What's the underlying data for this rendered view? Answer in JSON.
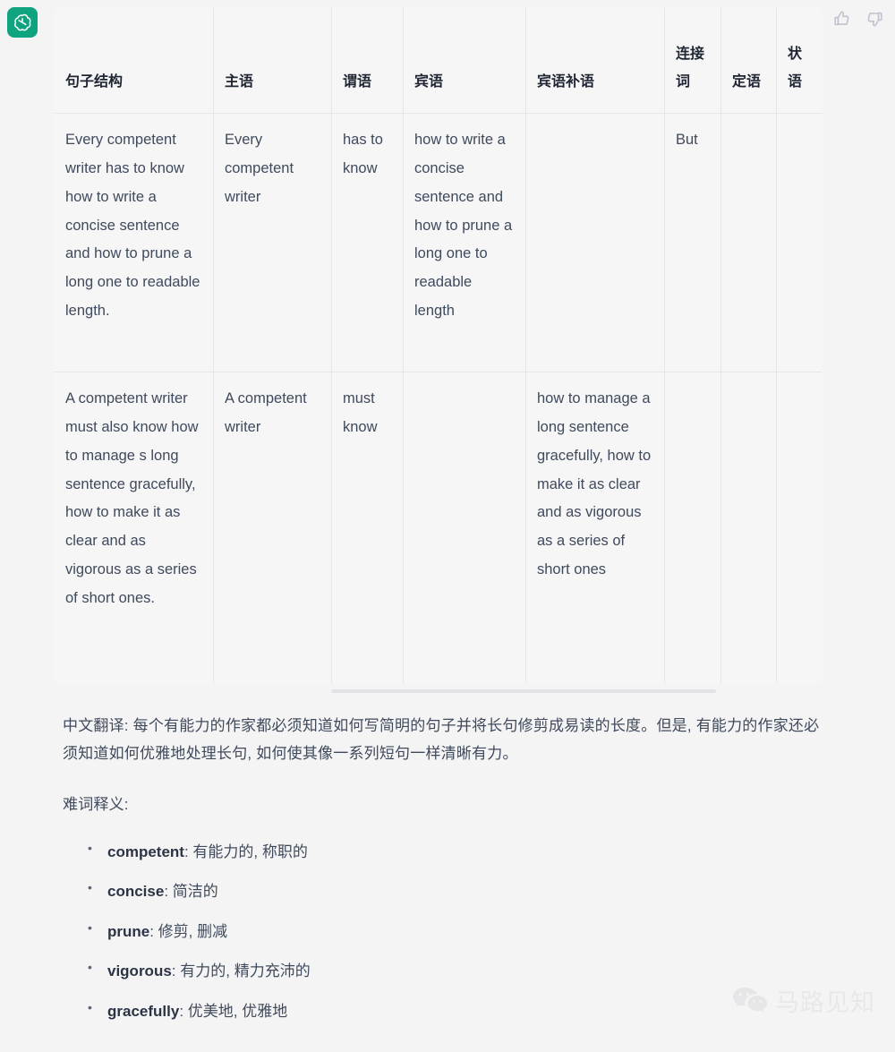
{
  "avatar": {
    "name": "chatgpt-logo"
  },
  "feedback": {
    "thumbs_up_label": "thumbs-up",
    "thumbs_down_label": "thumbs-down"
  },
  "table": {
    "headers": [
      "句子结构",
      "主语",
      "谓语",
      "宾语",
      "宾语补语",
      "连接词",
      "定语",
      "状语"
    ],
    "rows": [
      {
        "sentence": "Every competent writer has to know how to write a concise sentence and how to prune a long one to readable length.",
        "subject": "Every competent writer",
        "predicate": "has to know",
        "object": "how to write a concise sentence and how to prune a long one to readable length",
        "object_complement": "",
        "conjunction": "But",
        "attributive": "",
        "adverbial": ""
      },
      {
        "sentence": "A competent writer must also know how to manage s long sentence gracefully, how to make it as clear and as vigorous as a series of short ones.",
        "subject": "A competent writer",
        "predicate": "must know",
        "object": "",
        "object_complement": "how to manage a long sentence gracefully, how to make it as clear and as vigorous as a series of short ones",
        "conjunction": "",
        "attributive": "",
        "adverbial": ""
      }
    ]
  },
  "translation": {
    "text": "中文翻译: 每个有能力的作家都必须知道如何写简明的句子并将长句修剪成易读的长度。但是, 有能力的作家还必须知道如何优雅地处理长句, 如何使其像一系列短句一样清晰有力。"
  },
  "vocab_section": {
    "title": "难词释义:",
    "items": [
      {
        "term": "competent",
        "definition": ": 有能力的, 称职的"
      },
      {
        "term": "concise",
        "definition": ": 简洁的"
      },
      {
        "term": "prune",
        "definition": ": 修剪, 删减"
      },
      {
        "term": "vigorous",
        "definition": ": 有力的, 精力充沛的"
      },
      {
        "term": "gracefully",
        "definition": ": 优美地, 优雅地"
      }
    ]
  },
  "watermark": {
    "text": "马路见知",
    "icon": "wechat-icon"
  },
  "colors": {
    "background": "#f4f4f5",
    "avatar_green": "#10a37f",
    "text": "#3f4a5c",
    "header_text": "#1f2533",
    "border": "#e6e6ea",
    "watermark": "#e8e8ea"
  }
}
